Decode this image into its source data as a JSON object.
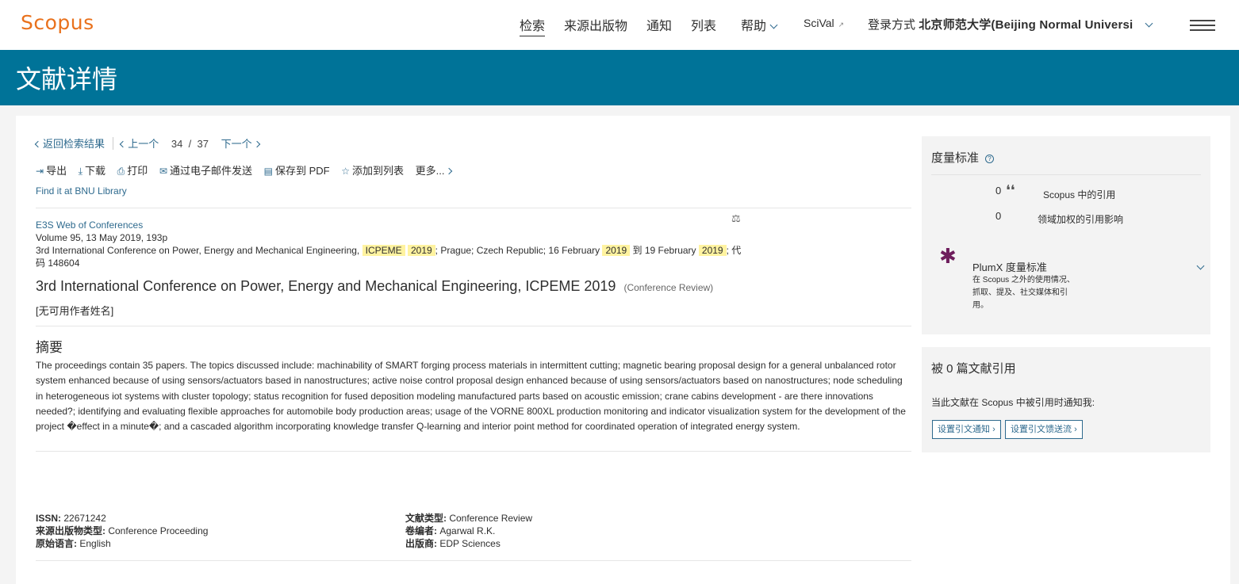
{
  "header": {
    "logo": "Scopus",
    "nav": [
      {
        "label": "检索",
        "active": true
      },
      {
        "label": "来源出版物"
      },
      {
        "label": "通知"
      },
      {
        "label": "列表"
      },
      {
        "label": "帮助"
      },
      {
        "label": "SciVal"
      }
    ],
    "login_prefix": "登录方式",
    "institution": "北京师范大学(Beijing Normal Universi",
    "page_title": "文献详情"
  },
  "nav_row": {
    "back": "返回检索结果",
    "prev": "上一个",
    "current": "34",
    "slash": "/",
    "total": "37",
    "next": "下一个"
  },
  "toolbar": {
    "export": "导出",
    "download": "下载",
    "print": "打印",
    "email": "通过电子邮件发送",
    "save_pdf": "保存到 PDF",
    "add_list": "添加到列表",
    "more": "更多..."
  },
  "library_link": "Find it at BNU Library",
  "source": {
    "journal": "E3S Web of Conferences",
    "volume": "Volume 95, 13 May 2019, 193p",
    "conf_a": "3rd International Conference on Power, Energy and Mechanical Engineering,",
    "hl_icpeme": "ICPEME",
    "hl_2019": "2019",
    "conf_b": "; Prague; Czech Republic; 16 February",
    "conf_c": "到 19 February",
    "conf_d": "; 代",
    "conf_code": "码 148604"
  },
  "document": {
    "title": "3rd International Conference on Power, Energy and Mechanical Engineering, ICPEME 2019",
    "type_tag": "(Conference Review)",
    "authors": "[无可用作者姓名]"
  },
  "abstract": {
    "heading": "摘要",
    "text": "The proceedings contain 35 papers. The topics discussed include: machinability of SMART forging process materials in intermittent cutting; magnetic bearing proposal design for a general unbalanced rotor system enhanced because of using sensors/actuators based in nanostructures; active noise control proposal design enhanced because of using sensors/actuators based on nanostructures; node scheduling in heterogeneous iot systems with cluster topology; status recognition for fused deposition modeling manufactured parts based on acoustic emission; crane cabins development - are there innovations needed?; identifying and evaluating flexible approaches for automobile body production areas; usage of the VORNE 800XL production monitoring and indicator visualization system for the development of the project �effect in a minute�; and a cascaded algorithm incorporating knowledge transfer Q-learning and interior point method for coordinated operation of integrated energy system."
  },
  "info": {
    "issn_label": "ISSN:",
    "issn": "22671242",
    "srctype_label": "来源出版物类型:",
    "srctype": "Conference Proceeding",
    "lang_label": "原始语言:",
    "lang": "English",
    "doctype_label": "文献类型:",
    "doctype": "Conference Review",
    "editor_label": "卷编者:",
    "editor": "Agarwal R.K.",
    "publisher_label": "出版商:",
    "publisher": "EDP Sciences"
  },
  "metrics": {
    "heading": "度量标准",
    "citations_value": "0",
    "citations_label": "Scopus 中的引用",
    "fwci_value": "0",
    "fwci_label": "领域加权的引用影响",
    "plumx_title": "PlumX 度量标准",
    "plumx_text": "在 Scopus 之外的使用情况、抓取、提及、社交媒体和引用。"
  },
  "cited_by": {
    "heading": "被 0 篇文献引用",
    "notify_text": "当此文献在 Scopus 中被引用时通知我:",
    "btn_alert": "设置引文通知",
    "btn_feed": "设置引文馈送流"
  }
}
